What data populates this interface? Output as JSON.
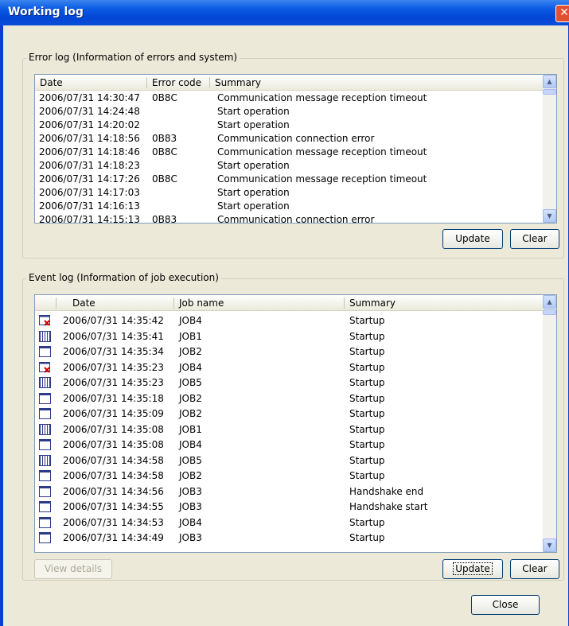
{
  "window": {
    "title": "Working log",
    "close_glyph": "✕"
  },
  "error_log": {
    "legend": "Error log (Information of errors and system)",
    "columns": [
      "Date",
      "Error code",
      "Summary"
    ],
    "rows": [
      {
        "date": "2006/07/31 14:30:47",
        "code": "0B8C",
        "summary": "Communication message reception timeout"
      },
      {
        "date": "2006/07/31 14:24:48",
        "code": "",
        "summary": "Start operation"
      },
      {
        "date": "2006/07/31 14:20:02",
        "code": "",
        "summary": "Start operation"
      },
      {
        "date": "2006/07/31 14:18:56",
        "code": "0B83",
        "summary": "Communication connection error"
      },
      {
        "date": "2006/07/31 14:18:46",
        "code": "0B8C",
        "summary": "Communication message reception timeout"
      },
      {
        "date": "2006/07/31 14:18:23",
        "code": "",
        "summary": "Start operation"
      },
      {
        "date": "2006/07/31 14:17:26",
        "code": "0B8C",
        "summary": "Communication message reception timeout"
      },
      {
        "date": "2006/07/31 14:17:03",
        "code": "",
        "summary": "Start operation"
      },
      {
        "date": "2006/07/31 14:16:13",
        "code": "",
        "summary": "Start operation"
      },
      {
        "date": "2006/07/31 14:15:13",
        "code": "0B83",
        "summary": "Communication connection error"
      }
    ],
    "update_label": "Update",
    "clear_label": "Clear"
  },
  "event_log": {
    "legend": "Event log (Information of job execution)",
    "columns": [
      "Date",
      "Job name",
      "Summary"
    ],
    "rows": [
      {
        "icon": "error-doc",
        "date": "2006/07/31 14:35:42",
        "job": "JOB4",
        "summary": "Startup"
      },
      {
        "icon": "grid-doc",
        "date": "2006/07/31 14:35:41",
        "job": "JOB1",
        "summary": "Startup"
      },
      {
        "icon": "doc",
        "date": "2006/07/31 14:35:34",
        "job": "JOB2",
        "summary": "Startup"
      },
      {
        "icon": "error-doc",
        "date": "2006/07/31 14:35:23",
        "job": "JOB4",
        "summary": "Startup"
      },
      {
        "icon": "grid-doc",
        "date": "2006/07/31 14:35:23",
        "job": "JOB5",
        "summary": "Startup"
      },
      {
        "icon": "doc",
        "date": "2006/07/31 14:35:18",
        "job": "JOB2",
        "summary": "Startup"
      },
      {
        "icon": "doc",
        "date": "2006/07/31 14:35:09",
        "job": "JOB2",
        "summary": "Startup"
      },
      {
        "icon": "grid-doc",
        "date": "2006/07/31 14:35:08",
        "job": "JOB1",
        "summary": "Startup"
      },
      {
        "icon": "doc",
        "date": "2006/07/31 14:35:08",
        "job": "JOB4",
        "summary": "Startup"
      },
      {
        "icon": "grid-doc",
        "date": "2006/07/31 14:34:58",
        "job": "JOB5",
        "summary": "Startup"
      },
      {
        "icon": "doc",
        "date": "2006/07/31 14:34:58",
        "job": "JOB2",
        "summary": "Startup"
      },
      {
        "icon": "doc",
        "date": "2006/07/31 14:34:56",
        "job": "JOB3",
        "summary": "Handshake end"
      },
      {
        "icon": "doc",
        "date": "2006/07/31 14:34:55",
        "job": "JOB3",
        "summary": "Handshake start"
      },
      {
        "icon": "doc",
        "date": "2006/07/31 14:34:53",
        "job": "JOB4",
        "summary": "Startup"
      },
      {
        "icon": "doc",
        "date": "2006/07/31 14:34:49",
        "job": "JOB3",
        "summary": "Startup"
      }
    ],
    "view_details_label": "View details",
    "update_label": "Update",
    "clear_label": "Clear"
  },
  "close_label": "Close",
  "colors": {
    "title_bar": "#0a5ae3",
    "dialog_bg": "#ece9d8",
    "close_button": "#e2512f",
    "error_mark": "#d00000"
  }
}
